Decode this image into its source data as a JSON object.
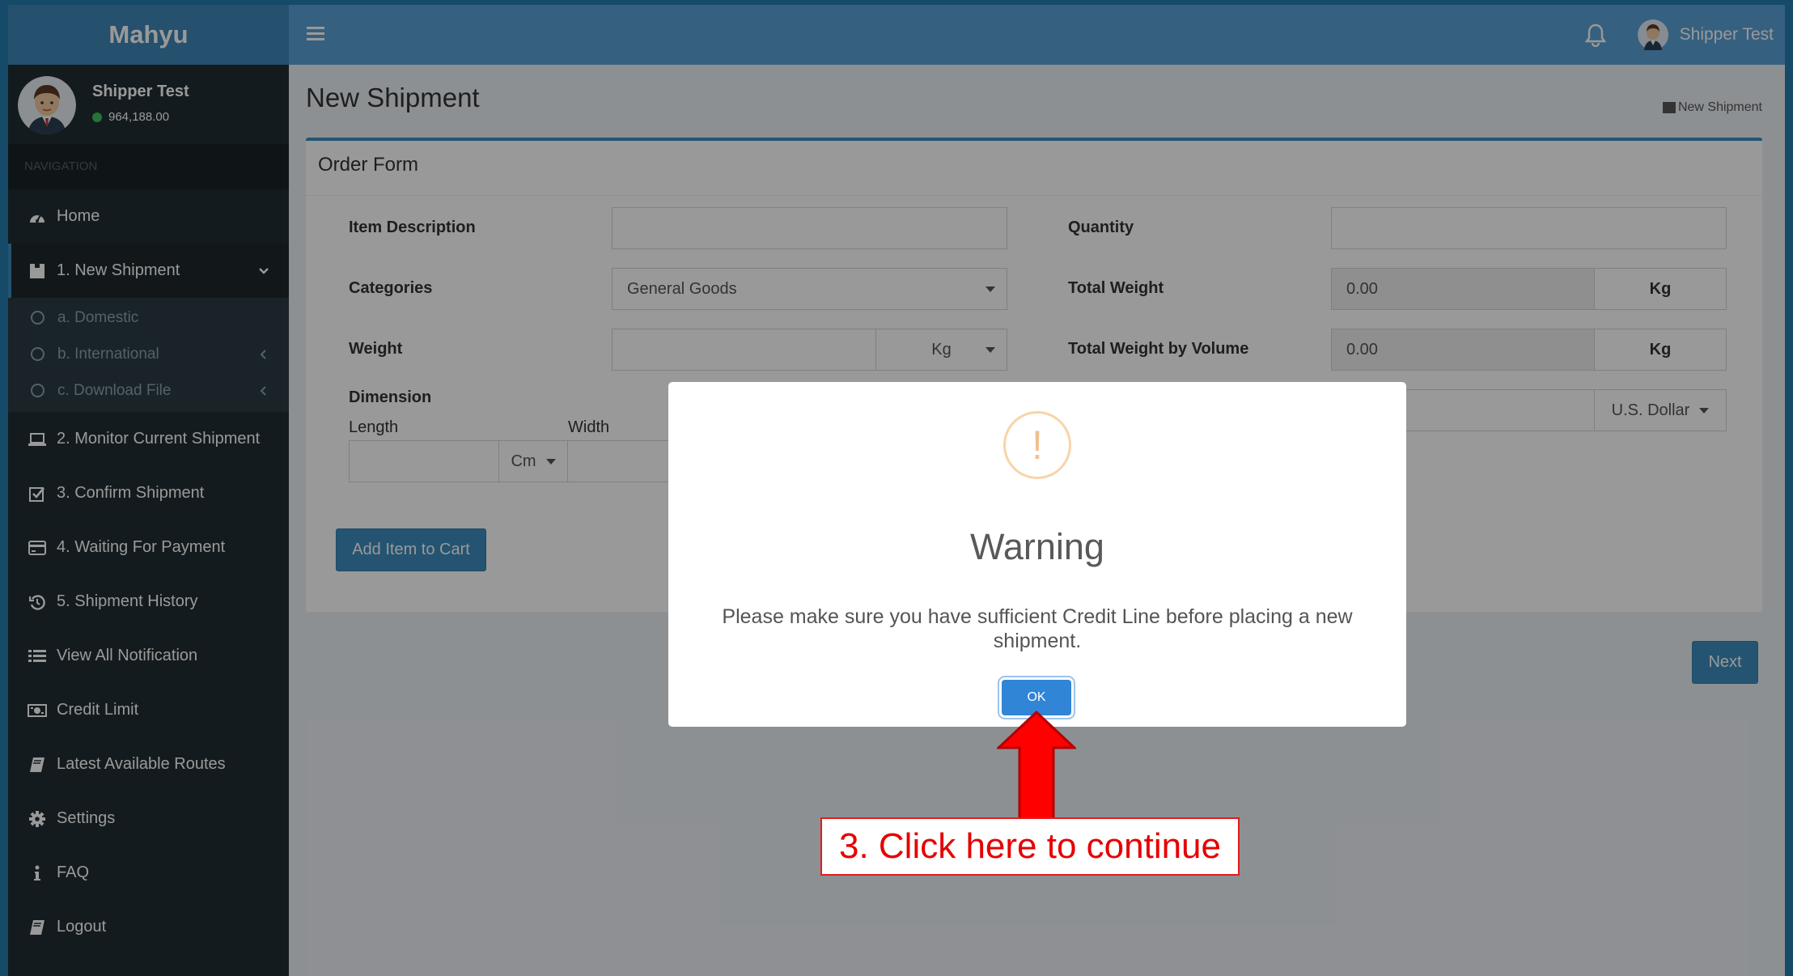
{
  "app": {
    "brand": "Mahyu",
    "user_name": "Shipper Test",
    "balance": "964,188.00",
    "breadcrumb": "New Shipment"
  },
  "sidebar": {
    "nav_header": "NAVIGATION",
    "items": [
      {
        "label": "Home",
        "icon": "dashboard-icon"
      },
      {
        "label": "1. New Shipment",
        "icon": "shipment-icon"
      },
      {
        "label": "2. Monitor Current Shipment",
        "icon": "laptop-icon"
      },
      {
        "label": "3. Confirm Shipment",
        "icon": "check-square-icon"
      },
      {
        "label": "4. Waiting For Payment",
        "icon": "credit-card-icon"
      },
      {
        "label": "5. Shipment History",
        "icon": "history-icon"
      },
      {
        "label": "View All Notification",
        "icon": "list-icon"
      },
      {
        "label": "Credit Limit",
        "icon": "money-icon"
      },
      {
        "label": "Latest Available Routes",
        "icon": "book-icon"
      },
      {
        "label": "Settings",
        "icon": "gear-icon"
      },
      {
        "label": "FAQ",
        "icon": "info-icon"
      },
      {
        "label": "Logout",
        "icon": "book-icon"
      }
    ],
    "subitems": [
      {
        "label": "a. Domestic"
      },
      {
        "label": "b. International"
      },
      {
        "label": "c. Download File"
      }
    ]
  },
  "page": {
    "title": "New Shipment",
    "box_title": "Order Form"
  },
  "form": {
    "item_description_label": "Item Description",
    "item_description_value": "",
    "quantity_label": "Quantity",
    "quantity_value": "",
    "categories_label": "Categories",
    "categories_value": "General Goods",
    "total_weight_label": "Total Weight",
    "total_weight_value": "0.00",
    "total_weight_unit": "Kg",
    "weight_label": "Weight",
    "weight_value": "",
    "weight_unit": "Kg",
    "total_weight_volume_label": "Total Weight by Volume",
    "total_weight_volume_value": "0.00",
    "total_weight_volume_unit": "Kg",
    "dimension_label": "Dimension",
    "length_label": "Length",
    "width_label": "Width",
    "dimension_unit": "Cm",
    "currency": "U.S. Dollar",
    "add_to_cart": "Add Item to Cart",
    "next": "Next"
  },
  "modal": {
    "icon": "!",
    "title": "Warning",
    "message": "Please make sure you have sufficient Credit Line before placing a new shipment.",
    "ok": "OK"
  },
  "annotation": {
    "text": "3. Click here to continue"
  },
  "colors": {
    "header_blue": "#5aa0d4",
    "brand_blue": "#3f85b8",
    "sidebar_dark": "#222d32",
    "ok_button": "#3085d6",
    "annotation_red": "#e60000"
  }
}
